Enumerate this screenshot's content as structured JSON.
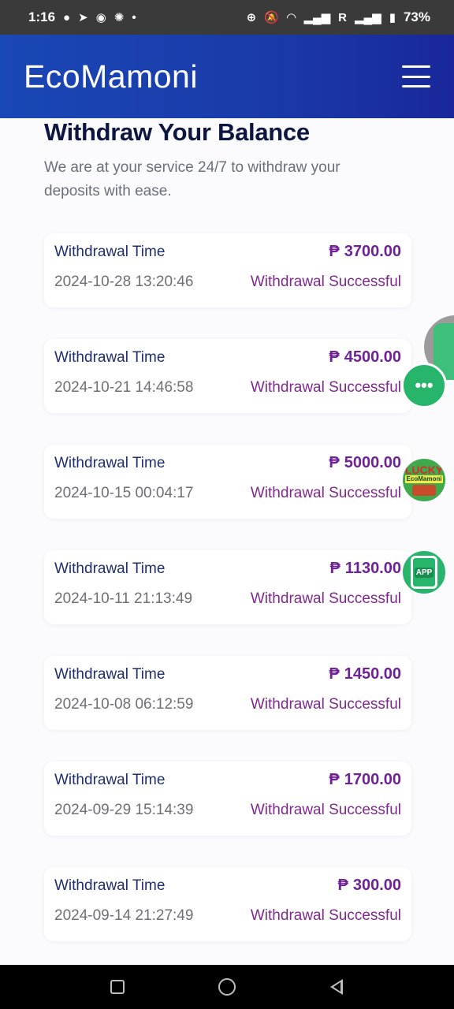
{
  "status_bar": {
    "time": "1:16",
    "carrier_indicator": "R",
    "battery": "73%"
  },
  "header": {
    "brand": "EcoMamoni"
  },
  "page": {
    "title": "Withdraw Your Balance",
    "subtitle": "We are at your service 24/7 to withdraw your deposits with ease."
  },
  "withdrawals": [
    {
      "label": "Withdrawal Time",
      "currency": "₱",
      "amount": "3700.00",
      "time": "2024-10-28 13:20:46",
      "status": "Withdrawal Successful"
    },
    {
      "label": "Withdrawal Time",
      "currency": "₱",
      "amount": "4500.00",
      "time": "2024-10-21 14:46:58",
      "status": "Withdrawal Successful"
    },
    {
      "label": "Withdrawal Time",
      "currency": "₱",
      "amount": "5000.00",
      "time": "2024-10-15 00:04:17",
      "status": "Withdrawal Successful"
    },
    {
      "label": "Withdrawal Time",
      "currency": "₱",
      "amount": "1130.00",
      "time": "2024-10-11 21:13:49",
      "status": "Withdrawal Successful"
    },
    {
      "label": "Withdrawal Time",
      "currency": "₱",
      "amount": "1450.00",
      "time": "2024-10-08 06:12:59",
      "status": "Withdrawal Successful"
    },
    {
      "label": "Withdrawal Time",
      "currency": "₱",
      "amount": "1700.00",
      "time": "2024-09-29 15:14:39",
      "status": "Withdrawal Successful"
    },
    {
      "label": "Withdrawal Time",
      "currency": "₱",
      "amount": "300.00",
      "time": "2024-09-14 21:27:49",
      "status": "Withdrawal Successful"
    }
  ],
  "floating": {
    "chat_icon": "chat-bubble-icon",
    "lucky_title": "LUCKY",
    "lucky_brand": "EcoMamoni",
    "app_label": "APP"
  },
  "colors": {
    "header_start": "#1a47b6",
    "header_end": "#19279a",
    "amount": "#6f2295",
    "status": "#80288f",
    "label": "#1f2f6e"
  }
}
